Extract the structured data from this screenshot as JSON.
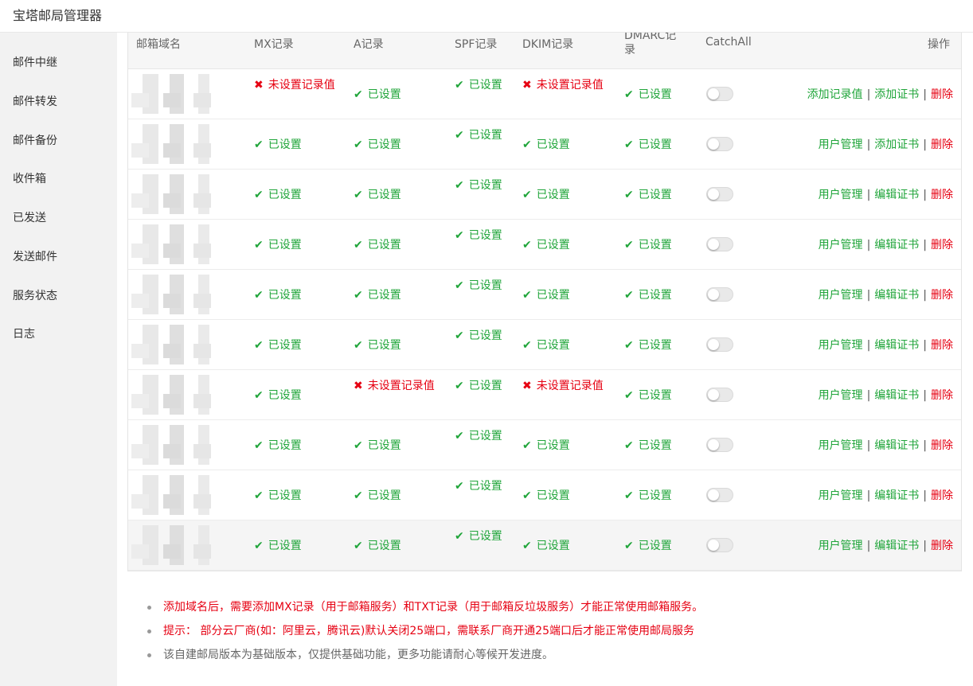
{
  "app": {
    "title": "宝塔邮局管理器"
  },
  "sidebar": {
    "items": [
      {
        "label": "邮件中继"
      },
      {
        "label": "邮件转发"
      },
      {
        "label": "邮件备份"
      },
      {
        "label": "收件箱"
      },
      {
        "label": "已发送"
      },
      {
        "label": "发送邮件"
      },
      {
        "label": "服务状态"
      },
      {
        "label": "日志"
      }
    ]
  },
  "table": {
    "headers": {
      "domain": "邮箱域名",
      "mx": "MX记录",
      "a": "A记录",
      "spf": "SPF记录",
      "dkim": "DKIM记录",
      "dmarc": "DMARC记录",
      "catchall": "CatchAll",
      "ops": "操作"
    },
    "status_ok": "已设置",
    "status_bad": "未设置记录值",
    "rows": [
      {
        "mx": false,
        "a": true,
        "spf": true,
        "dkim": false,
        "dmarc": true,
        "catchall": false,
        "ops": [
          "添加记录值",
          "添加证书",
          "删除"
        ]
      },
      {
        "mx": true,
        "a": true,
        "spf": true,
        "dkim": true,
        "dmarc": true,
        "catchall": false,
        "ops": [
          "用户管理",
          "添加证书",
          "删除"
        ]
      },
      {
        "mx": true,
        "a": true,
        "spf": true,
        "dkim": true,
        "dmarc": true,
        "catchall": false,
        "ops": [
          "用户管理",
          "编辑证书",
          "删除"
        ]
      },
      {
        "mx": true,
        "a": true,
        "spf": true,
        "dkim": true,
        "dmarc": true,
        "catchall": false,
        "ops": [
          "用户管理",
          "编辑证书",
          "删除"
        ]
      },
      {
        "mx": true,
        "a": true,
        "spf": true,
        "dkim": true,
        "dmarc": true,
        "catchall": false,
        "ops": [
          "用户管理",
          "编辑证书",
          "删除"
        ]
      },
      {
        "mx": true,
        "a": true,
        "spf": true,
        "dkim": true,
        "dmarc": true,
        "catchall": false,
        "ops": [
          "用户管理",
          "编辑证书",
          "删除"
        ]
      },
      {
        "mx": true,
        "a": false,
        "spf": true,
        "dkim": false,
        "dmarc": true,
        "catchall": false,
        "ops": [
          "用户管理",
          "编辑证书",
          "删除"
        ]
      },
      {
        "mx": true,
        "a": true,
        "spf": true,
        "dkim": true,
        "dmarc": true,
        "catchall": false,
        "ops": [
          "用户管理",
          "编辑证书",
          "删除"
        ]
      },
      {
        "mx": true,
        "a": true,
        "spf": true,
        "dkim": true,
        "dmarc": true,
        "catchall": false,
        "ops": [
          "用户管理",
          "编辑证书",
          "删除"
        ]
      },
      {
        "mx": true,
        "a": true,
        "spf": true,
        "dkim": true,
        "dmarc": true,
        "catchall": false,
        "ops": [
          "用户管理",
          "编辑证书",
          "删除"
        ]
      }
    ]
  },
  "notes": [
    {
      "text": "添加域名后，需要添加MX记录（用于邮箱服务）和TXT记录（用于邮箱反垃圾服务）才能正常使用邮箱服务。",
      "color": "#e60012"
    },
    {
      "text": "提示： 部分云厂商(如：阿里云，腾讯云)默认关闭25端口，需联系厂商开通25端口后才能正常使用邮局服务",
      "color": "#e60012"
    },
    {
      "text": "该自建邮局版本为基础版本，仅提供基础功能，更多功能请耐心等候开发进度。",
      "color": "#666666"
    }
  ],
  "colors": {
    "accent": "#20a53a",
    "danger": "#e60012"
  }
}
